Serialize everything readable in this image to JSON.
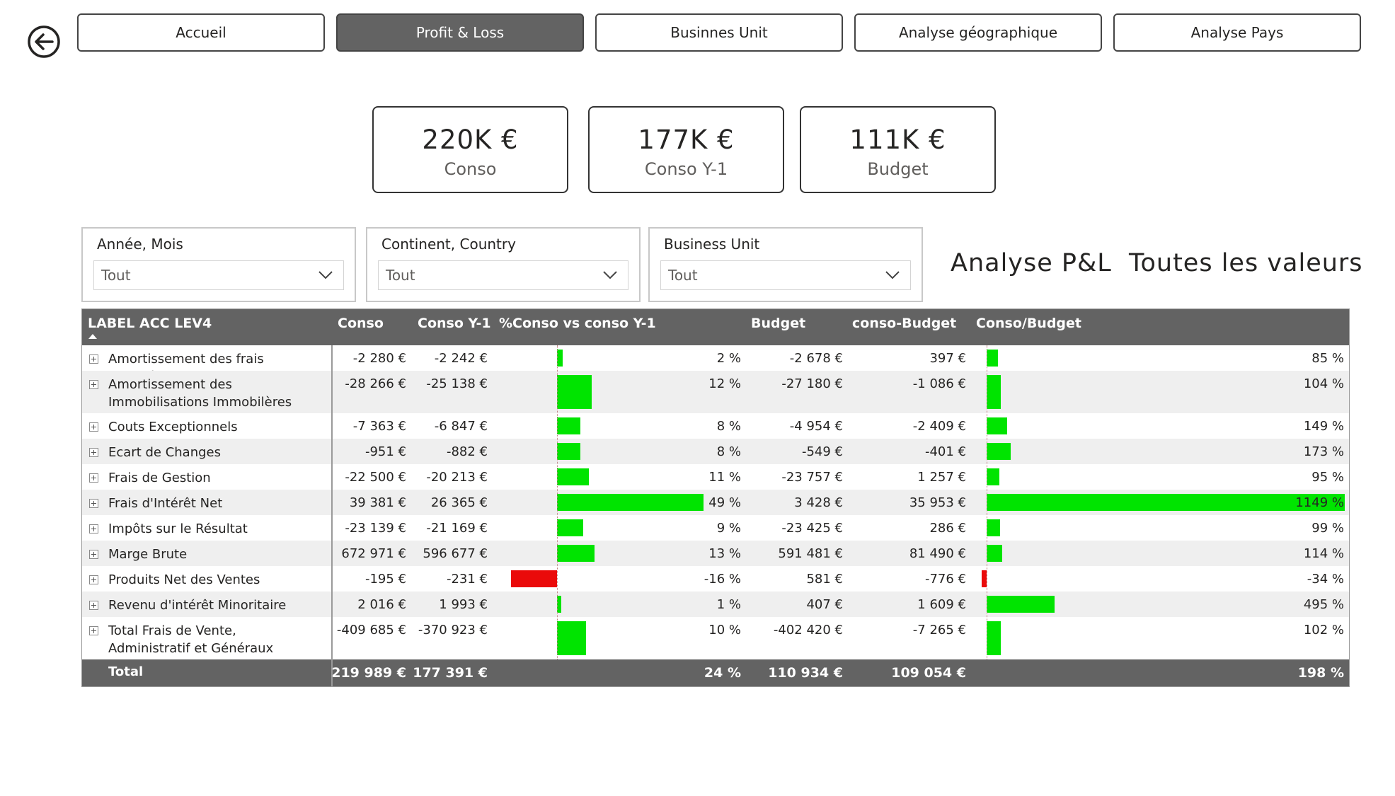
{
  "nav": {
    "items": [
      {
        "label": "Accueil",
        "active": false
      },
      {
        "label": "Profit & Loss",
        "active": true
      },
      {
        "label": "Businnes Unit",
        "active": false
      },
      {
        "label": "Analyse géographique",
        "active": false
      },
      {
        "label": "Analyse Pays",
        "active": false
      }
    ]
  },
  "kpis": [
    {
      "value": "220K €",
      "label": "Conso"
    },
    {
      "value": "177K €",
      "label": "Conso Y-1"
    },
    {
      "value": "111K €",
      "label": "Budget"
    }
  ],
  "slicers": [
    {
      "title": "Année, Mois",
      "value": "Tout"
    },
    {
      "title": "Continent, Country",
      "value": "Tout"
    },
    {
      "title": "Business Unit",
      "value": "Tout"
    }
  ],
  "report_title": "Analyse P&L  Toutes les valeurs",
  "table": {
    "headers": {
      "label": "LABEL ACC LEV4",
      "conso": "Conso",
      "conso_y1": "Conso Y-1",
      "pct_y1": "%Conso vs conso Y-1",
      "budget": "Budget",
      "conso_budget": "conso-Budget",
      "ratio_budget": "Conso/Budget"
    },
    "rows": [
      {
        "label": "Amortissement des frais reportés",
        "conso": "-2 280 €",
        "conso_y1": "-2 242 €",
        "pct_y1": "2 %",
        "pct_y1_value": 2,
        "budget": "-2 678 €",
        "conso_budget": "397 €",
        "ratio": "85 %",
        "ratio_value": 85
      },
      {
        "label": "Amortissement des Immobilisations Immobilères",
        "conso": "-28 266 €",
        "conso_y1": "-25 138 €",
        "pct_y1": "12 %",
        "pct_y1_value": 12,
        "budget": "-27 180 €",
        "conso_budget": "-1 086 €",
        "ratio": "104 %",
        "ratio_value": 104
      },
      {
        "label": "Couts Exceptionnels",
        "conso": "-7 363 €",
        "conso_y1": "-6 847 €",
        "pct_y1": "8 %",
        "pct_y1_value": 8,
        "budget": "-4 954 €",
        "conso_budget": "-2 409 €",
        "ratio": "149 %",
        "ratio_value": 149
      },
      {
        "label": "Ecart de Changes",
        "conso": "-951 €",
        "conso_y1": "-882 €",
        "pct_y1": "8 %",
        "pct_y1_value": 8,
        "budget": "-549 €",
        "conso_budget": "-401 €",
        "ratio": "173 %",
        "ratio_value": 173
      },
      {
        "label": "Frais de Gestion",
        "conso": "-22 500 €",
        "conso_y1": "-20 213 €",
        "pct_y1": "11 %",
        "pct_y1_value": 11,
        "budget": "-23 757 €",
        "conso_budget": "1 257 €",
        "ratio": "95 %",
        "ratio_value": 95
      },
      {
        "label": "Frais d'Intérêt Net",
        "conso": "39 381 €",
        "conso_y1": "26 365 €",
        "pct_y1": "49 %",
        "pct_y1_value": 49,
        "budget": "3 428 €",
        "conso_budget": "35 953 €",
        "ratio": "1149 %",
        "ratio_value": 1149
      },
      {
        "label": "Impôts sur le Résultat",
        "conso": "-23 139 €",
        "conso_y1": "-21 169 €",
        "pct_y1": "9 %",
        "pct_y1_value": 9,
        "budget": "-23 425 €",
        "conso_budget": "286 €",
        "ratio": "99 %",
        "ratio_value": 99
      },
      {
        "label": "Marge Brute",
        "conso": "672 971 €",
        "conso_y1": "596 677 €",
        "pct_y1": "13 %",
        "pct_y1_value": 13,
        "budget": "591 481 €",
        "conso_budget": "81 490 €",
        "ratio": "114 %",
        "ratio_value": 114
      },
      {
        "label": "Produits Net des Ventes",
        "conso": "-195 €",
        "conso_y1": "-231 €",
        "pct_y1": "-16 %",
        "pct_y1_value": -16,
        "budget": "581 €",
        "conso_budget": "-776 €",
        "ratio": "-34 %",
        "ratio_value": -34
      },
      {
        "label": "Revenu d'intérêt Minoritaire",
        "conso": "2 016 €",
        "conso_y1": "1 993 €",
        "pct_y1": "1 %",
        "pct_y1_value": 1,
        "budget": "407 €",
        "conso_budget": "1 609 €",
        "ratio": "495 %",
        "ratio_value": 495
      },
      {
        "label": "Total Frais de Vente, Administratif et Généraux",
        "conso": "-409 685 €",
        "conso_y1": "-370 923 €",
        "pct_y1": "10 %",
        "pct_y1_value": 10,
        "budget": "-402 420 €",
        "conso_budget": "-7 265 €",
        "ratio": "102 %",
        "ratio_value": 102
      }
    ],
    "total": {
      "label": "Total",
      "conso": "219 989 €",
      "conso_y1": "177 391 €",
      "pct_y1": "24 %",
      "budget": "110 934 €",
      "conso_budget": "109 054 €",
      "ratio": "198 %"
    }
  },
  "colors": {
    "positive_bar": "#00e400",
    "negative_bar": "#ea0a0a",
    "header_bg": "#636363",
    "active_nav": "#636363"
  },
  "icons": {
    "back": "back-arrow-icon",
    "dropdown": "chevron-down-icon",
    "expand": "expand-plus-icon",
    "sort": "sort-up-icon"
  }
}
